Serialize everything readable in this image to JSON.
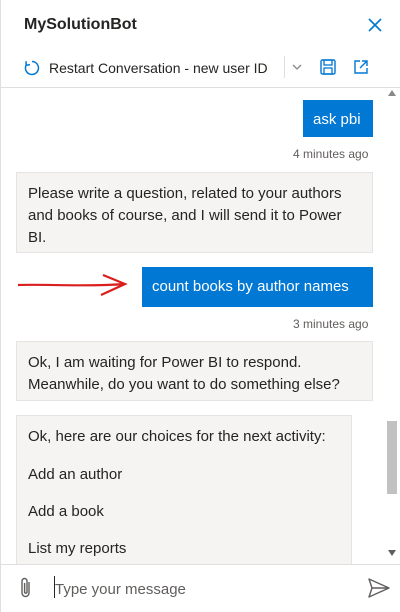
{
  "window": {
    "title": "MySolutionBot"
  },
  "toolbar": {
    "restart_label": "Restart Conversation - new user ID"
  },
  "messages": [
    {
      "from": "user",
      "text": "ask pbi",
      "time": "4 minutes ago"
    },
    {
      "from": "bot",
      "text": "Please write a question, related to your authors and books of course, and I will send it to Power BI."
    },
    {
      "from": "user",
      "text": "count books by author names",
      "time": "3 minutes ago"
    },
    {
      "from": "bot",
      "text": "Ok, I am waiting for Power BI to respond. Meanwhile, do you want to do something else?"
    },
    {
      "from": "bot",
      "text": "Ok, here are our choices for the next activity:",
      "choices": [
        "Add an author",
        "Add a book",
        "List my reports"
      ]
    }
  ],
  "composer": {
    "placeholder": "Type your message"
  },
  "colors": {
    "user_bubble": "#0078d4",
    "bot_bubble": "#f5f4f2",
    "accent": "#0078d4",
    "annotation_arrow": "#d9201f"
  }
}
